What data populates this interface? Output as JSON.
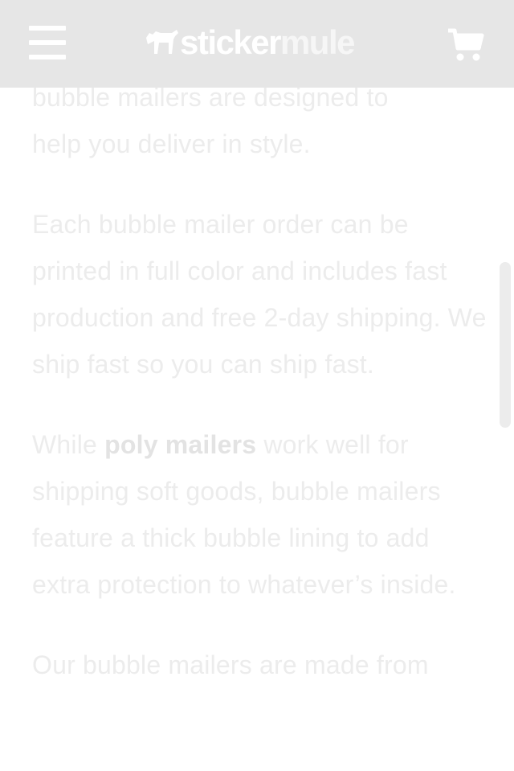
{
  "header": {
    "menu_icon": "hamburger-menu-icon",
    "logo": {
      "part1": "sticker",
      "part2": "mule",
      "mark_icon": "mule-icon"
    },
    "cart_icon": "shopping-cart-icon",
    "background": "#e6e6e6"
  },
  "article": {
    "para1_line1": "bubble mailers are designed to",
    "para1_line2": "help you deliver in style.",
    "para2": "Each bubble mailer order can be printed in full color and includes fast production and free 2-day shipping. We ship fast so you can ship fast.",
    "para3_before": "While ",
    "para3_link": "poly mailers",
    "para3_after": " work well for shipping soft goods, bubble mailers feature a thick bubble lining to add extra protection to whatever’s inside.",
    "para4": "Our bubble mailers are made from"
  }
}
